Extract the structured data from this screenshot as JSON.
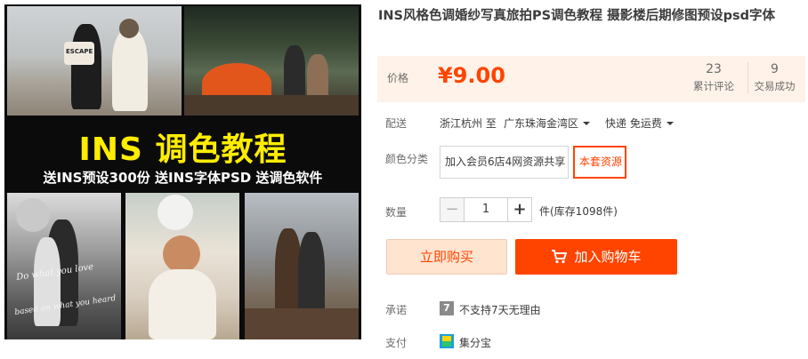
{
  "product": {
    "title": "INS风格色调婚纱写真旅拍PS调色教程 摄影楼后期修图预设psd字体"
  },
  "hero_image": {
    "banner_title": "INS 调色教程",
    "banner_sub": "送INS预设300份  送INS字体PSD  送调色软件",
    "script_text_1": "Do what you love",
    "script_text_2": "based on what you heard",
    "sign_text": "ESCAPE"
  },
  "price": {
    "label": "价格",
    "value": "¥9.00",
    "reviews_count": "23",
    "reviews_label": "累计评论",
    "deals_count": "9",
    "deals_label": "交易成功"
  },
  "shipping": {
    "label": "配送",
    "from": "浙江杭州 至",
    "to": "广东珠海金湾区",
    "method": "快递 免运费"
  },
  "sku": {
    "label": "颜色分类",
    "options": [
      "加入会员6店4网资源共享",
      "本套资源"
    ],
    "selected_index": 1
  },
  "quantity": {
    "label": "数量",
    "minus": "−",
    "value": "1",
    "plus": "+",
    "stock_text": "件(库存1098件)"
  },
  "actions": {
    "buy_now": "立即购买",
    "add_to_cart": "加入购物车"
  },
  "promise": {
    "label": "承诺",
    "icon_text": "7",
    "text": "不支持7天无理由"
  },
  "payment": {
    "label": "支付",
    "text": "集分宝"
  },
  "colors": {
    "accent": "#ff4400",
    "price_bg": "#fff2e8",
    "buy_now_bg": "#ffe4d0",
    "banner_yellow": "#ffed00"
  }
}
